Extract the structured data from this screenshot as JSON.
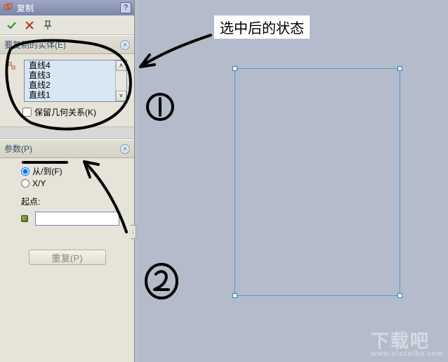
{
  "titlebar": {
    "title": "复制",
    "help": "?"
  },
  "entities": {
    "header": "要复制的实体(E)",
    "items": [
      "直线4",
      "直线3",
      "直线2",
      "直线1"
    ],
    "keep_relations": "保留几何关系(K)"
  },
  "params": {
    "header": "参数(P)",
    "from_to": "从/到(F)",
    "xy": "X/Y",
    "origin_label": "起点:"
  },
  "buttons": {
    "repeat": "重复(P)"
  },
  "annotation": {
    "selected_state": "选中后的状态"
  },
  "watermark": {
    "main": "下载吧",
    "sub": "www.xiazaiba.com"
  }
}
